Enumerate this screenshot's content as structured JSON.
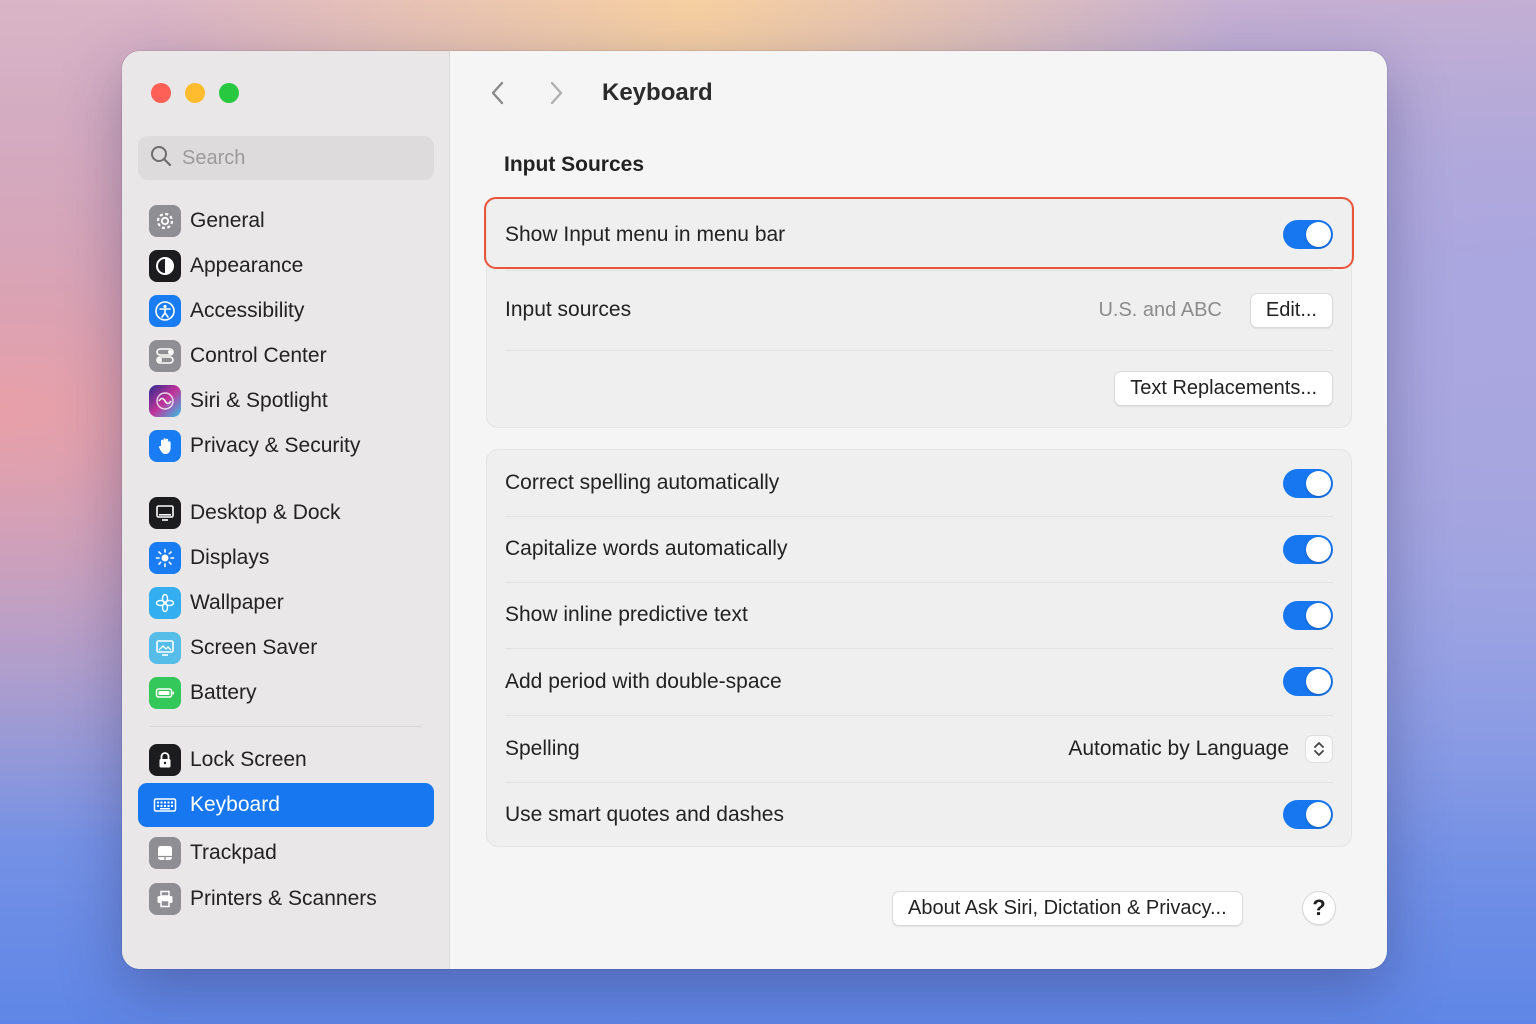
{
  "window": {
    "controls": [
      "close",
      "minimize",
      "zoom"
    ]
  },
  "search": {
    "placeholder": "Search"
  },
  "sidebar": {
    "groups": [
      [
        {
          "label": "General",
          "icon": "gear-icon",
          "color": "#8e8e93"
        },
        {
          "label": "Appearance",
          "icon": "appearance-icon",
          "color": "#1c1c1e"
        },
        {
          "label": "Accessibility",
          "icon": "accessibility-icon",
          "color": "#1a7cf2"
        },
        {
          "label": "Control Center",
          "icon": "control-center-icon",
          "color": "#8e8e93"
        },
        {
          "label": "Siri & Spotlight",
          "icon": "siri-icon",
          "color": "#6b3fd4"
        },
        {
          "label": "Privacy & Security",
          "icon": "hand-icon",
          "color": "#1a7cf2"
        }
      ],
      [
        {
          "label": "Desktop & Dock",
          "icon": "desktop-icon",
          "color": "#1c1c1e"
        },
        {
          "label": "Displays",
          "icon": "sun-icon",
          "color": "#1a7cf2"
        },
        {
          "label": "Wallpaper",
          "icon": "flower-icon",
          "color": "#33aef0"
        },
        {
          "label": "Screen Saver",
          "icon": "screen-saver-icon",
          "color": "#55bde8"
        },
        {
          "label": "Battery",
          "icon": "battery-icon",
          "color": "#34c759"
        }
      ],
      [
        {
          "label": "Lock Screen",
          "icon": "lock-icon",
          "color": "#1c1c1e"
        },
        {
          "label": "Keyboard",
          "icon": "keyboard-icon",
          "color": "#1777f0",
          "active": true
        },
        {
          "label": "Trackpad",
          "icon": "trackpad-icon",
          "color": "#8e8e93"
        },
        {
          "label": "Printers & Scanners",
          "icon": "printer-icon",
          "color": "#8e8e93"
        }
      ]
    ]
  },
  "header": {
    "title": "Keyboard"
  },
  "input_sources": {
    "section_title": "Input Sources",
    "show_input_menu": {
      "label": "Show Input menu in menu bar",
      "on": true
    },
    "sources": {
      "label": "Input sources",
      "value": "U.S. and ABC",
      "button": "Edit..."
    },
    "text_replacements_button": "Text Replacements..."
  },
  "text_input": {
    "rows": [
      {
        "label": "Correct spelling automatically",
        "on": true
      },
      {
        "label": "Capitalize words automatically",
        "on": true
      },
      {
        "label": "Show inline predictive text",
        "on": true
      },
      {
        "label": "Add period with double-space",
        "on": true
      }
    ],
    "spelling": {
      "label": "Spelling",
      "value": "Automatic by Language"
    },
    "smart_quotes": {
      "label": "Use smart quotes and dashes",
      "on": true
    }
  },
  "footer": {
    "about_button": "About Ask Siri, Dictation & Privacy...",
    "help_label": "?"
  },
  "colors": {
    "accent": "#1777f0",
    "highlight_border": "#e8553b"
  }
}
